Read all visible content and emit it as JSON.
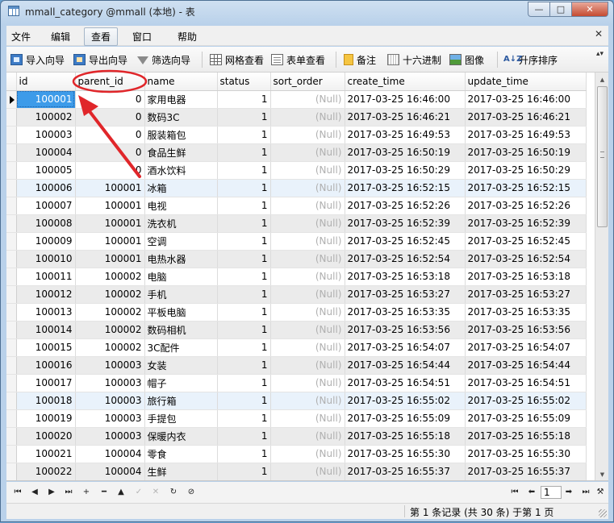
{
  "window": {
    "title": "mmall_category @mmall (本地) - 表",
    "controls": {
      "minimize": "—",
      "maximize": "□",
      "close": "✕"
    }
  },
  "menu": {
    "items": [
      "文件",
      "编辑",
      "查看",
      "窗口",
      "帮助"
    ],
    "active_index": 2,
    "close_glyph": "✕"
  },
  "toolbar": {
    "buttons": [
      {
        "label": "导入向导",
        "icon": "import-icon"
      },
      {
        "label": "导出向导",
        "icon": "export-icon"
      },
      {
        "label": "筛选向导",
        "icon": "filter-icon"
      },
      {
        "label": "网格查看",
        "icon": "grid-icon"
      },
      {
        "label": "表单查看",
        "icon": "form-icon"
      },
      {
        "label": "备注",
        "icon": "memo-icon"
      },
      {
        "label": "十六进制",
        "icon": "hex-icon"
      },
      {
        "label": "图像",
        "icon": "image-icon"
      },
      {
        "label": "升序排序",
        "icon": "sort-asc-icon",
        "icon_text": "A↓Z"
      }
    ],
    "more_glyph": "▴▾"
  },
  "grid": {
    "columns": [
      "id",
      "parent_id",
      "name",
      "status",
      "sort_order",
      "create_time",
      "update_time"
    ],
    "null_text": "(Null)",
    "rows": [
      [
        "100001",
        "0",
        "家用电器",
        "1",
        "(Null)",
        "2017-03-25 16:46:00",
        "2017-03-25 16:46:00"
      ],
      [
        "100002",
        "0",
        "数码3C",
        "1",
        "(Null)",
        "2017-03-25 16:46:21",
        "2017-03-25 16:46:21"
      ],
      [
        "100003",
        "0",
        "服装箱包",
        "1",
        "(Null)",
        "2017-03-25 16:49:53",
        "2017-03-25 16:49:53"
      ],
      [
        "100004",
        "0",
        "食品生鲜",
        "1",
        "(Null)",
        "2017-03-25 16:50:19",
        "2017-03-25 16:50:19"
      ],
      [
        "100005",
        "0",
        "酒水饮料",
        "1",
        "(Null)",
        "2017-03-25 16:50:29",
        "2017-03-25 16:50:29"
      ],
      [
        "100006",
        "100001",
        "冰箱",
        "1",
        "(Null)",
        "2017-03-25 16:52:15",
        "2017-03-25 16:52:15"
      ],
      [
        "100007",
        "100001",
        "电视",
        "1",
        "(Null)",
        "2017-03-25 16:52:26",
        "2017-03-25 16:52:26"
      ],
      [
        "100008",
        "100001",
        "洗衣机",
        "1",
        "(Null)",
        "2017-03-25 16:52:39",
        "2017-03-25 16:52:39"
      ],
      [
        "100009",
        "100001",
        "空调",
        "1",
        "(Null)",
        "2017-03-25 16:52:45",
        "2017-03-25 16:52:45"
      ],
      [
        "100010",
        "100001",
        "电热水器",
        "1",
        "(Null)",
        "2017-03-25 16:52:54",
        "2017-03-25 16:52:54"
      ],
      [
        "100011",
        "100002",
        "电脑",
        "1",
        "(Null)",
        "2017-03-25 16:53:18",
        "2017-03-25 16:53:18"
      ],
      [
        "100012",
        "100002",
        "手机",
        "1",
        "(Null)",
        "2017-03-25 16:53:27",
        "2017-03-25 16:53:27"
      ],
      [
        "100013",
        "100002",
        "平板电脑",
        "1",
        "(Null)",
        "2017-03-25 16:53:35",
        "2017-03-25 16:53:35"
      ],
      [
        "100014",
        "100002",
        "数码相机",
        "1",
        "(Null)",
        "2017-03-25 16:53:56",
        "2017-03-25 16:53:56"
      ],
      [
        "100015",
        "100002",
        "3C配件",
        "1",
        "(Null)",
        "2017-03-25 16:54:07",
        "2017-03-25 16:54:07"
      ],
      [
        "100016",
        "100003",
        "女装",
        "1",
        "(Null)",
        "2017-03-25 16:54:44",
        "2017-03-25 16:54:44"
      ],
      [
        "100017",
        "100003",
        "帽子",
        "1",
        "(Null)",
        "2017-03-25 16:54:51",
        "2017-03-25 16:54:51"
      ],
      [
        "100018",
        "100003",
        "旅行箱",
        "1",
        "(Null)",
        "2017-03-25 16:55:02",
        "2017-03-25 16:55:02"
      ],
      [
        "100019",
        "100003",
        "手提包",
        "1",
        "(Null)",
        "2017-03-25 16:55:09",
        "2017-03-25 16:55:09"
      ],
      [
        "100020",
        "100003",
        "保暖内衣",
        "1",
        "(Null)",
        "2017-03-25 16:55:18",
        "2017-03-25 16:55:18"
      ],
      [
        "100021",
        "100004",
        "零食",
        "1",
        "(Null)",
        "2017-03-25 16:55:30",
        "2017-03-25 16:55:30"
      ],
      [
        "100022",
        "100004",
        "生鲜",
        "1",
        "(Null)",
        "2017-03-25 16:55:37",
        "2017-03-25 16:55:37"
      ]
    ],
    "selected_row_index": 0,
    "highlighted_row_indices": [
      5,
      17
    ],
    "annotation_color": "#e0262a"
  },
  "navigation": {
    "buttons": [
      {
        "glyph": "⏮",
        "icon": "first-record-icon",
        "enabled": true
      },
      {
        "glyph": "◀",
        "icon": "prev-record-icon",
        "enabled": true
      },
      {
        "glyph": "▶",
        "icon": "next-record-icon",
        "enabled": true
      },
      {
        "glyph": "⏭",
        "icon": "last-record-icon",
        "enabled": true
      },
      {
        "glyph": "+",
        "icon": "add-record-icon",
        "enabled": true
      },
      {
        "glyph": "━",
        "icon": "delete-record-icon",
        "enabled": true
      },
      {
        "glyph": "▲",
        "icon": "edit-record-icon",
        "enabled": true
      },
      {
        "glyph": "✓",
        "icon": "apply-icon",
        "enabled": false
      },
      {
        "glyph": "✕",
        "icon": "discard-icon",
        "enabled": false
      },
      {
        "glyph": "↻",
        "icon": "refresh-icon",
        "enabled": true
      },
      {
        "glyph": "⊘",
        "icon": "stop-icon",
        "enabled": true
      }
    ],
    "page_buttons": [
      {
        "glyph": "⏮",
        "icon": "first-page-icon"
      },
      {
        "glyph": "⬅",
        "icon": "prev-page-icon"
      },
      {
        "glyph": "➡",
        "icon": "next-page-icon"
      },
      {
        "glyph": "⏭",
        "icon": "last-page-icon"
      },
      {
        "glyph": "⚒",
        "icon": "settings-tools-icon"
      }
    ],
    "page": "1"
  },
  "status": {
    "text": "第 1 条记录 (共 30 条) 于第 1 页"
  }
}
